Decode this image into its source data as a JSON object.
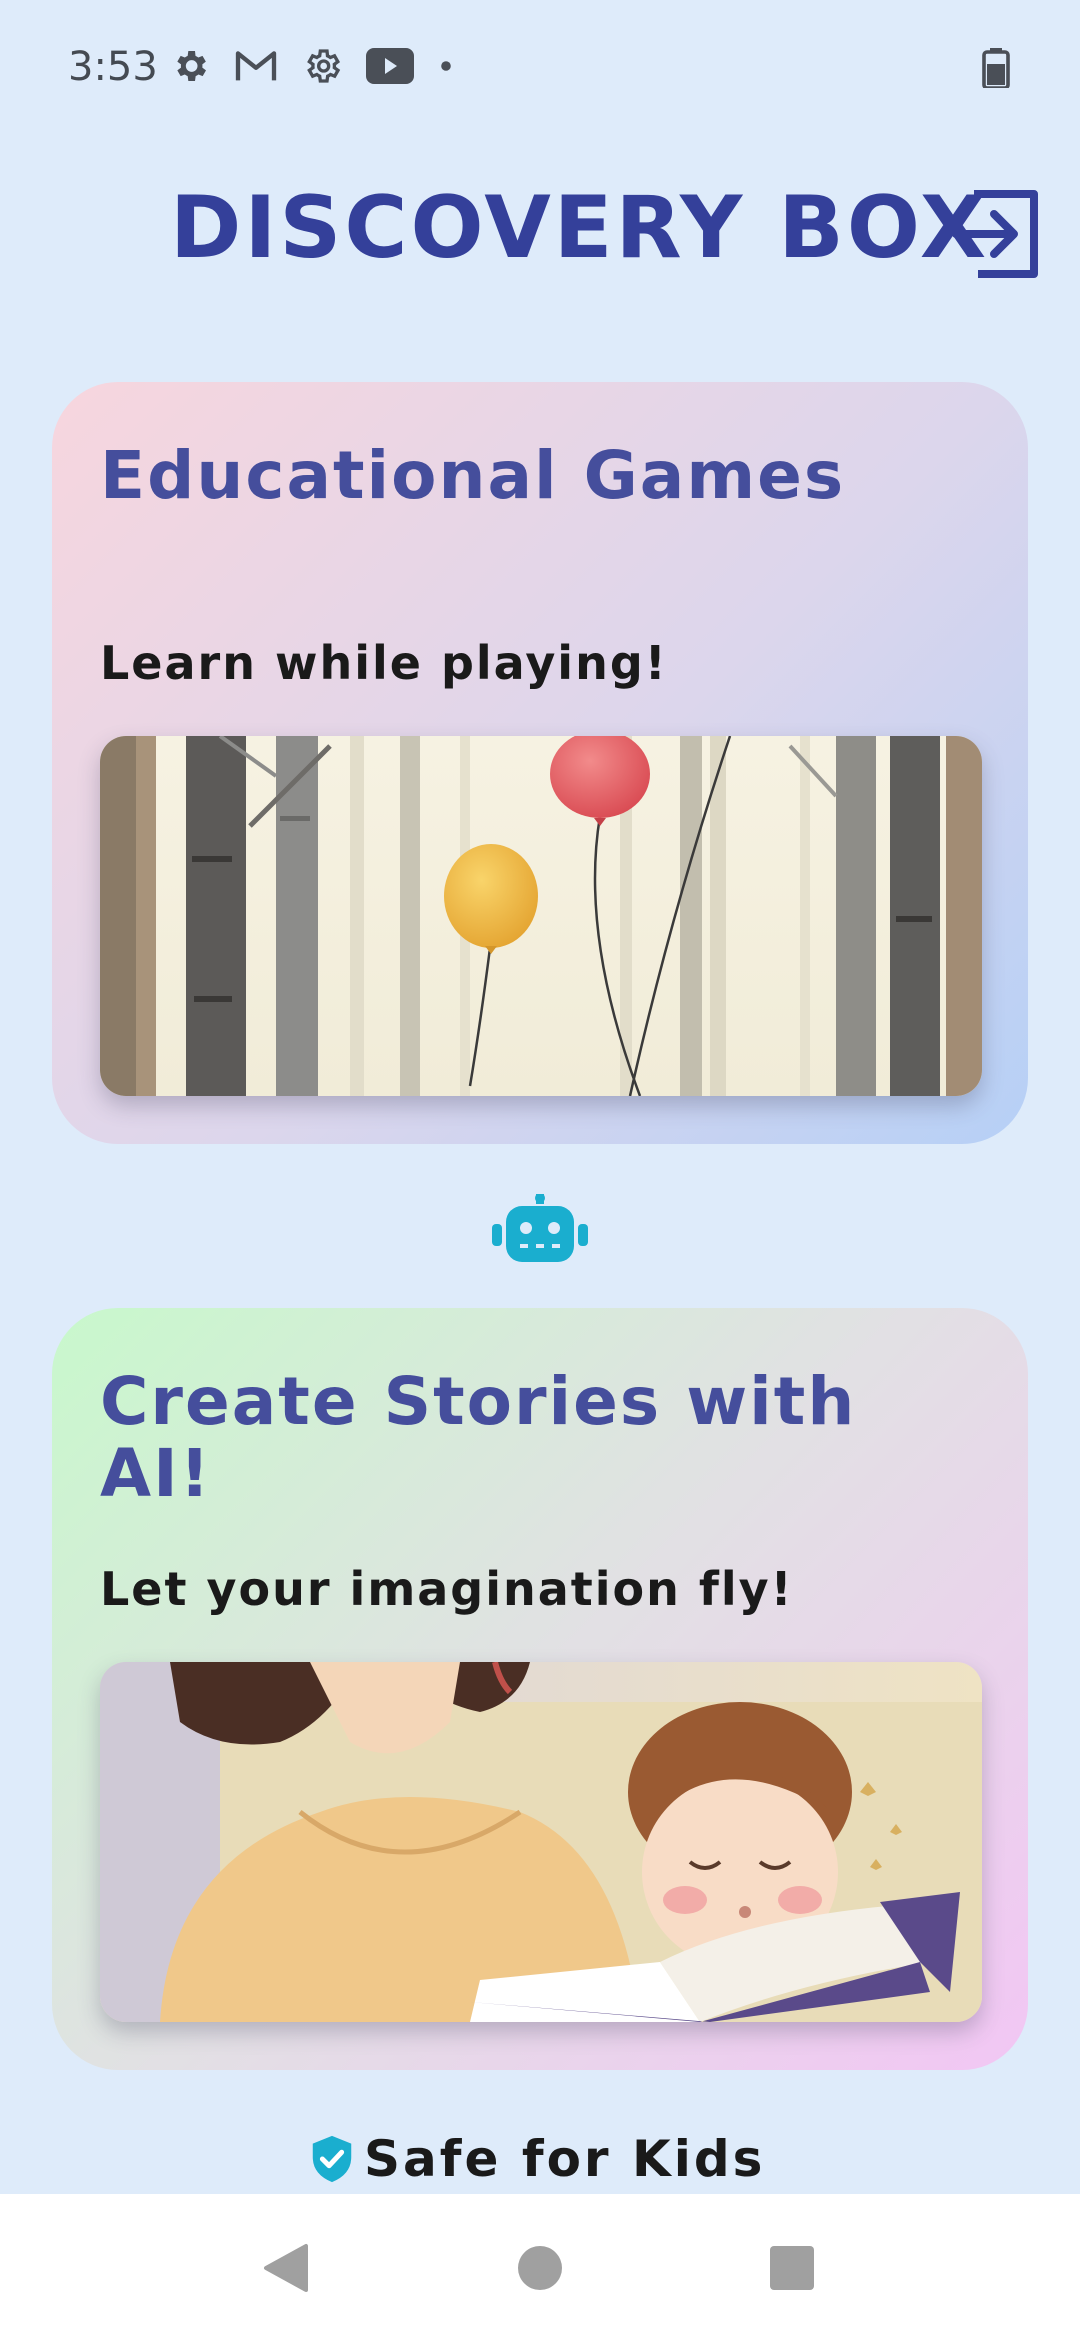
{
  "status_bar": {
    "time": "3:53",
    "icons": [
      "settings-icon",
      "gmail-icon",
      "settings-icon",
      "youtube-icon",
      "dot-icon"
    ],
    "battery_icon": "battery-icon"
  },
  "header": {
    "title": "DISCOVERY BOX",
    "logout_icon": "logout-icon"
  },
  "cards": [
    {
      "title": "Educational Games",
      "subtitle": "Learn while playing!",
      "image": "balloons-in-forest-illustration"
    },
    {
      "title": "Create Stories with AI!",
      "subtitle": "Let your imagination fly!",
      "image": "mother-reading-to-child-illustration"
    }
  ],
  "divider_icon": "robot-icon",
  "footer": {
    "badge_icon": "shield-check-icon",
    "badge_text": "Safe for Kids"
  },
  "nav_bar": {
    "buttons": [
      "back",
      "home",
      "recents"
    ]
  },
  "colors": {
    "background": "#deebfa",
    "title": "#34409a",
    "card_title": "#454e9c",
    "accent": "#1aaecf"
  }
}
